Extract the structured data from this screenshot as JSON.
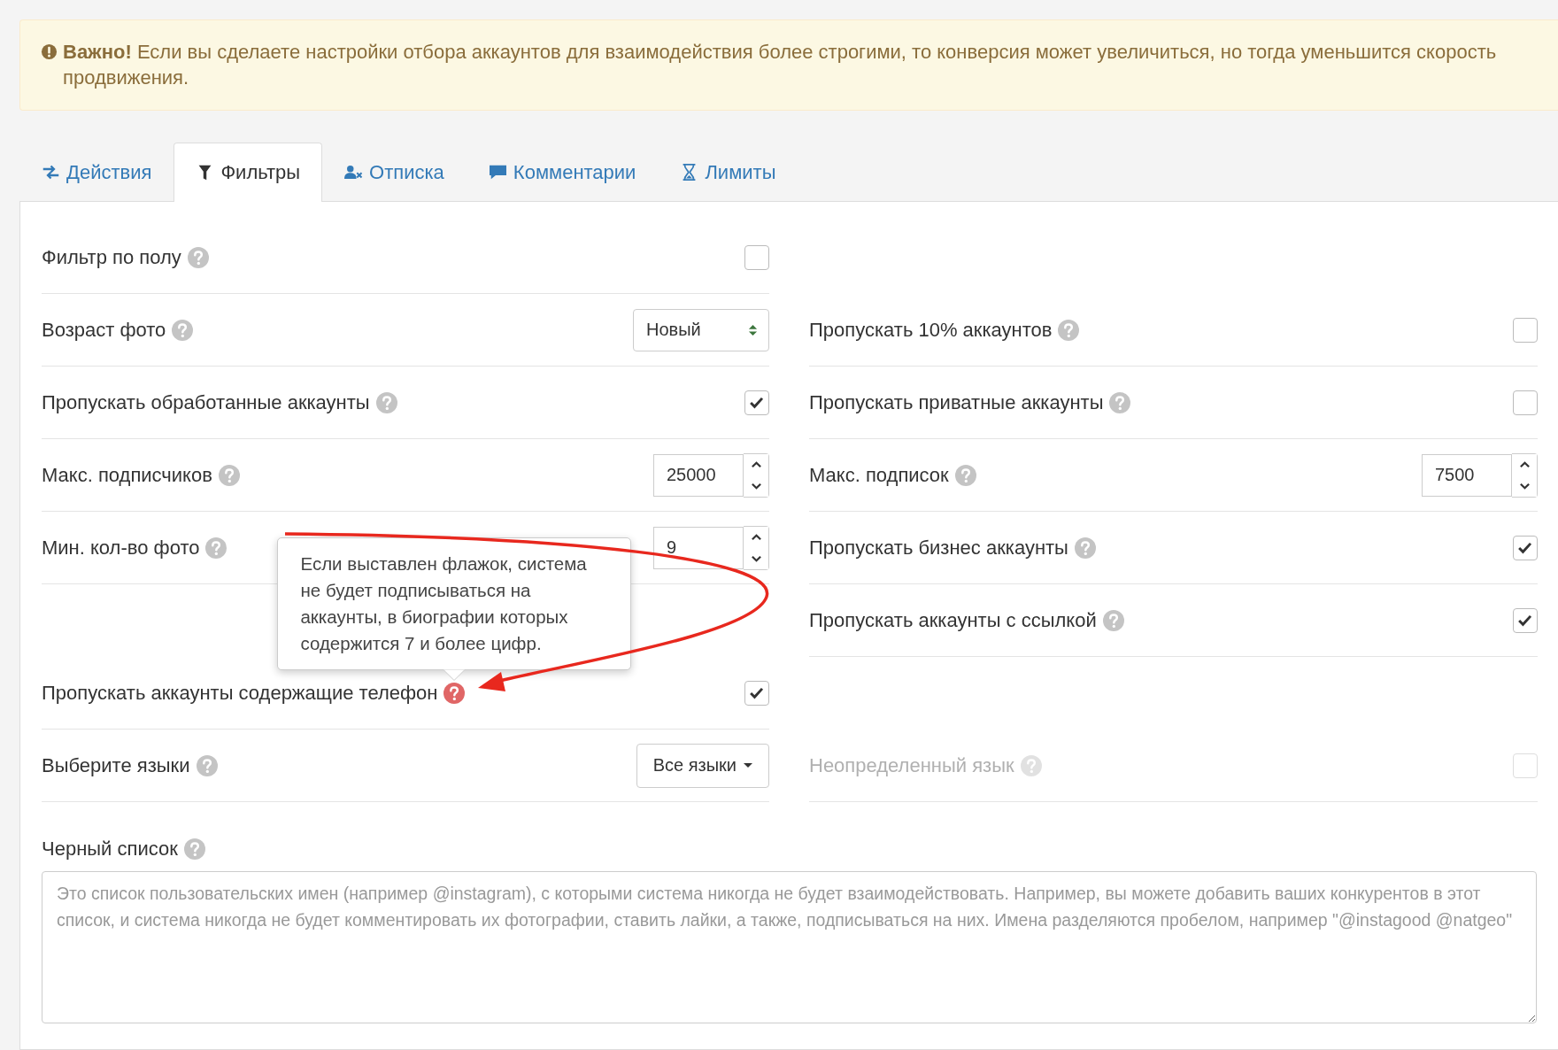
{
  "alert": {
    "text": "**Важно!** Если вы сделаете настройки отбора аккаунтов для взаимодействия более строгими, то конверсия может увеличиться, но тогда уменьшится скорость продвижения."
  },
  "tabs": [
    {
      "label": "Действия",
      "selected": false
    },
    {
      "label": "Фильтры",
      "selected": true
    },
    {
      "label": "Отписка",
      "selected": false
    },
    {
      "label": "Комментарии",
      "selected": false
    },
    {
      "label": "Лимиты",
      "selected": false
    }
  ],
  "left_column": [
    {
      "kind": "checkbox",
      "label": "Фильтр по полу",
      "checked": false,
      "disabled": false,
      "help_active": false
    },
    {
      "kind": "select",
      "label": "Возраст фото",
      "value": "Новый",
      "disabled": false,
      "help_active": false
    },
    {
      "kind": "checkbox",
      "label": "Пропускать обработанные аккаунты",
      "checked": true,
      "disabled": false,
      "help_active": false
    },
    {
      "kind": "number",
      "label": "Макс. подписчиков",
      "value": "25000",
      "disabled": false,
      "help_active": false
    },
    {
      "kind": "number",
      "label": "Мин. кол-во фото",
      "value": "9",
      "disabled": false,
      "help_active": false
    },
    {
      "kind": "empty"
    },
    {
      "kind": "checkbox",
      "label": "Пропускать аккаунты содержащие телефон",
      "checked": true,
      "disabled": false,
      "help_active": true,
      "tooltip": "Если выставлен флажок, система не будет подписываться на аккаунты, в биографии которых содержится 7 и более цифр."
    },
    {
      "kind": "dropdown",
      "label": "Выберите языки",
      "value": "Все языки",
      "disabled": false,
      "help_active": false
    }
  ],
  "right_column": [
    {
      "kind": "empty"
    },
    {
      "kind": "checkbox",
      "label": "Пропускать 10% аккаунтов",
      "checked": false,
      "disabled": false,
      "help_active": false
    },
    {
      "kind": "checkbox",
      "label": "Пропускать приватные аккаунты",
      "checked": false,
      "disabled": false,
      "help_active": false
    },
    {
      "kind": "number",
      "label": "Макс. подписок",
      "value": "7500",
      "disabled": false,
      "help_active": false
    },
    {
      "kind": "checkbox",
      "label": "Пропускать бизнес аккаунты",
      "checked": true,
      "disabled": false,
      "help_active": false
    },
    {
      "kind": "checkbox",
      "label": "Пропускать аккаунты с ссылкой",
      "checked": true,
      "disabled": false,
      "help_active": false
    },
    {
      "kind": "empty"
    },
    {
      "kind": "checkbox",
      "label": "Неопределенный язык",
      "checked": false,
      "disabled": true,
      "help_active": false
    }
  ],
  "blacklist": {
    "label": "Черный список",
    "placeholder": "Это список пользовательских имен (например @instagram), с которыми система никогда не будет взаимодействовать. Например, вы можете добавить ваших конкурентов в этот список, и система никогда не будет комментировать их фотографии, ставить лайки, а также, подписываться на них. Имена разделяются пробелом, например \"@instagood @natgeo\""
  }
}
